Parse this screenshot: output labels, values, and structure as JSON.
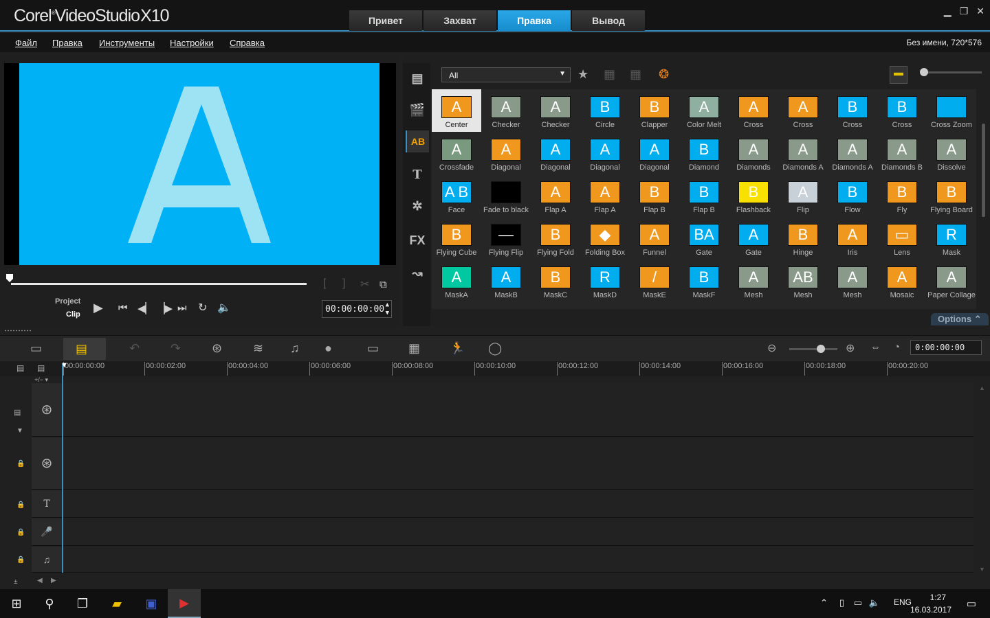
{
  "app": {
    "title": "Corel VideoStudio X10",
    "logo_main": "Corel",
    "logo_product": "VideoStudio",
    "logo_version": "X10"
  },
  "tabs": [
    {
      "label": "Привет",
      "active": false
    },
    {
      "label": "Захват",
      "active": false
    },
    {
      "label": "Правка",
      "active": true
    },
    {
      "label": "Вывод",
      "active": false
    }
  ],
  "window_controls": {
    "minimize": "▁",
    "restore": "❐",
    "close": "✕"
  },
  "menu": [
    "Файл",
    "Правка",
    "Инструменты",
    "Настройки",
    "Справка"
  ],
  "project_info": "Без имени, 720*576",
  "preview": {
    "letter": "A",
    "mode_project": "Project",
    "mode_clip": "Clip",
    "timecode": "00:00:00:00",
    "controls": [
      "play-icon",
      "start-icon",
      "prev-frame-icon",
      "next-frame-icon",
      "end-icon",
      "repeat-icon",
      "volume-icon"
    ],
    "mark_in": "[",
    "mark_out": "]"
  },
  "library": {
    "filter": "All",
    "sidebar": [
      {
        "name": "media",
        "glyph": "🎞",
        "active": false
      },
      {
        "name": "instant-project",
        "glyph": "🎬",
        "active": false
      },
      {
        "name": "transition",
        "glyph": "AB",
        "active": true
      },
      {
        "name": "title",
        "glyph": "T",
        "active": false
      },
      {
        "name": "graphic",
        "glyph": "✲",
        "active": false
      },
      {
        "name": "filter",
        "glyph": "FX",
        "active": false
      },
      {
        "name": "path",
        "glyph": "↝",
        "active": false
      }
    ],
    "options_label": "Options",
    "transitions": [
      {
        "label": "Center",
        "color": "#f0981e",
        "glyph": "A",
        "selected": true
      },
      {
        "label": "Checker",
        "color": "#8a9a8a",
        "glyph": "A"
      },
      {
        "label": "Checker",
        "color": "#8a9a8a",
        "glyph": "A"
      },
      {
        "label": "Circle",
        "color": "#00aef0",
        "glyph": "B"
      },
      {
        "label": "Clapper",
        "color": "#f0981e",
        "glyph": "B"
      },
      {
        "label": "Color Melt",
        "color": "#8fb0a0",
        "glyph": "A"
      },
      {
        "label": "Cross",
        "color": "#f0981e",
        "glyph": "A"
      },
      {
        "label": "Cross",
        "color": "#f0981e",
        "glyph": "A"
      },
      {
        "label": "Cross",
        "color": "#00aef0",
        "glyph": "B"
      },
      {
        "label": "Cross",
        "color": "#00aef0",
        "glyph": "B"
      },
      {
        "label": "Cross Zoom",
        "color": "#00aef0",
        "glyph": ""
      },
      {
        "label": "Crossfade",
        "color": "#7a9a80",
        "glyph": "A"
      },
      {
        "label": "Diagonal",
        "color": "#f0981e",
        "glyph": "A"
      },
      {
        "label": "Diagonal",
        "color": "#00aef0",
        "glyph": "A"
      },
      {
        "label": "Diagonal",
        "color": "#00aef0",
        "glyph": "A"
      },
      {
        "label": "Diagonal",
        "color": "#00aef0",
        "glyph": "A"
      },
      {
        "label": "Diamond",
        "color": "#00aef0",
        "glyph": "B"
      },
      {
        "label": "Diamonds",
        "color": "#8a9a8a",
        "glyph": "A"
      },
      {
        "label": "Diamonds A",
        "color": "#8a9a8a",
        "glyph": "A"
      },
      {
        "label": "Diamonds A",
        "color": "#8a9a8a",
        "glyph": "A"
      },
      {
        "label": "Diamonds B",
        "color": "#8a9a8a",
        "glyph": "A"
      },
      {
        "label": "Dissolve",
        "color": "#8a9a8a",
        "glyph": "A"
      },
      {
        "label": "Face",
        "color": "#00aef0",
        "glyph": "A B"
      },
      {
        "label": "Fade to black",
        "color": "#000000",
        "glyph": ""
      },
      {
        "label": "Flap A",
        "color": "#f0981e",
        "glyph": "A"
      },
      {
        "label": "Flap A",
        "color": "#f0981e",
        "glyph": "A"
      },
      {
        "label": "Flap B",
        "color": "#f0981e",
        "glyph": "B"
      },
      {
        "label": "Flap B",
        "color": "#00aef0",
        "glyph": "B"
      },
      {
        "label": "Flashback",
        "color": "#f8e000",
        "glyph": "B"
      },
      {
        "label": "Flip",
        "color": "#c8d0d8",
        "glyph": "A"
      },
      {
        "label": "Flow",
        "color": "#00aef0",
        "glyph": "B"
      },
      {
        "label": "Fly",
        "color": "#f0981e",
        "glyph": "B"
      },
      {
        "label": "Flying Board",
        "color": "#f0981e",
        "glyph": "B"
      },
      {
        "label": "Flying Cube",
        "color": "#f0981e",
        "glyph": "B"
      },
      {
        "label": "Flying Flip",
        "color": "#000000",
        "glyph": "—"
      },
      {
        "label": "Flying Fold",
        "color": "#f0981e",
        "glyph": "B"
      },
      {
        "label": "Folding Box",
        "color": "#f0981e",
        "glyph": "◆"
      },
      {
        "label": "Funnel",
        "color": "#f0981e",
        "glyph": "A"
      },
      {
        "label": "Gate",
        "color": "#00aef0",
        "glyph": "BA"
      },
      {
        "label": "Gate",
        "color": "#00aef0",
        "glyph": "A"
      },
      {
        "label": "Hinge",
        "color": "#f0981e",
        "glyph": "B"
      },
      {
        "label": "Iris",
        "color": "#f0981e",
        "glyph": "A"
      },
      {
        "label": "Lens",
        "color": "#f0981e",
        "glyph": "▭"
      },
      {
        "label": "Mask",
        "color": "#00aef0",
        "glyph": "R"
      },
      {
        "label": "MaskA",
        "color": "#00c8a0",
        "glyph": "A"
      },
      {
        "label": "MaskB",
        "color": "#00aef0",
        "glyph": "A"
      },
      {
        "label": "MaskC",
        "color": "#f0981e",
        "glyph": "B"
      },
      {
        "label": "MaskD",
        "color": "#00aef0",
        "glyph": "R"
      },
      {
        "label": "MaskE",
        "color": "#f0981e",
        "glyph": "/"
      },
      {
        "label": "MaskF",
        "color": "#00aef0",
        "glyph": "B"
      },
      {
        "label": "Mesh",
        "color": "#8a9a8a",
        "glyph": "A"
      },
      {
        "label": "Mesh",
        "color": "#8a9a8a",
        "glyph": "AB"
      },
      {
        "label": "Mesh",
        "color": "#8a9a8a",
        "glyph": "A"
      },
      {
        "label": "Mosaic",
        "color": "#f0981e",
        "glyph": "A"
      },
      {
        "label": "Paper Collage",
        "color": "#8a9a8a",
        "glyph": "A"
      }
    ]
  },
  "timeline": {
    "timecode": "0:00:00:00",
    "ticks": [
      "00:00:00:00",
      "00:00:02:00",
      "00:00:04:00",
      "00:00:06:00",
      "00:00:08:00",
      "00:00:10:00",
      "00:00:12:00",
      "00:00:14:00",
      "00:00:16:00",
      "00:00:18:00",
      "00:00:20:00"
    ],
    "tracks": [
      "video-track",
      "overlay-track",
      "title-track",
      "voice-track",
      "music-track"
    ]
  },
  "taskbar": {
    "lang": "ENG",
    "time": "1:27",
    "date": "16.03.2017"
  }
}
